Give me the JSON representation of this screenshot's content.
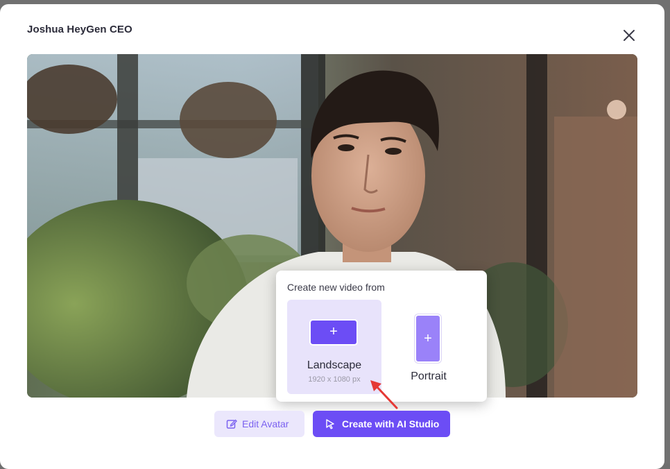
{
  "modal": {
    "title": "Joshua HeyGen CEO",
    "close_icon": "close-icon"
  },
  "video": {
    "description_icon": "avatar-video-preview"
  },
  "popover": {
    "title": "Create new video from",
    "options": [
      {
        "label": "Landscape",
        "sublabel": "1920 x 1080 px",
        "icon": "plus-icon",
        "selected": true
      },
      {
        "label": "Portrait",
        "icon": "plus-icon",
        "selected": false
      }
    ]
  },
  "actions": {
    "edit_label": "Edit Avatar",
    "edit_icon": "edit-icon",
    "create_label": "Create with AI Studio",
    "create_icon": "cursor-pointer-icon"
  },
  "colors": {
    "accent": "#6c4df5",
    "accent_light": "#ebe7fc",
    "selected_bg": "#e8e3fb",
    "annotation": "#e53935"
  }
}
